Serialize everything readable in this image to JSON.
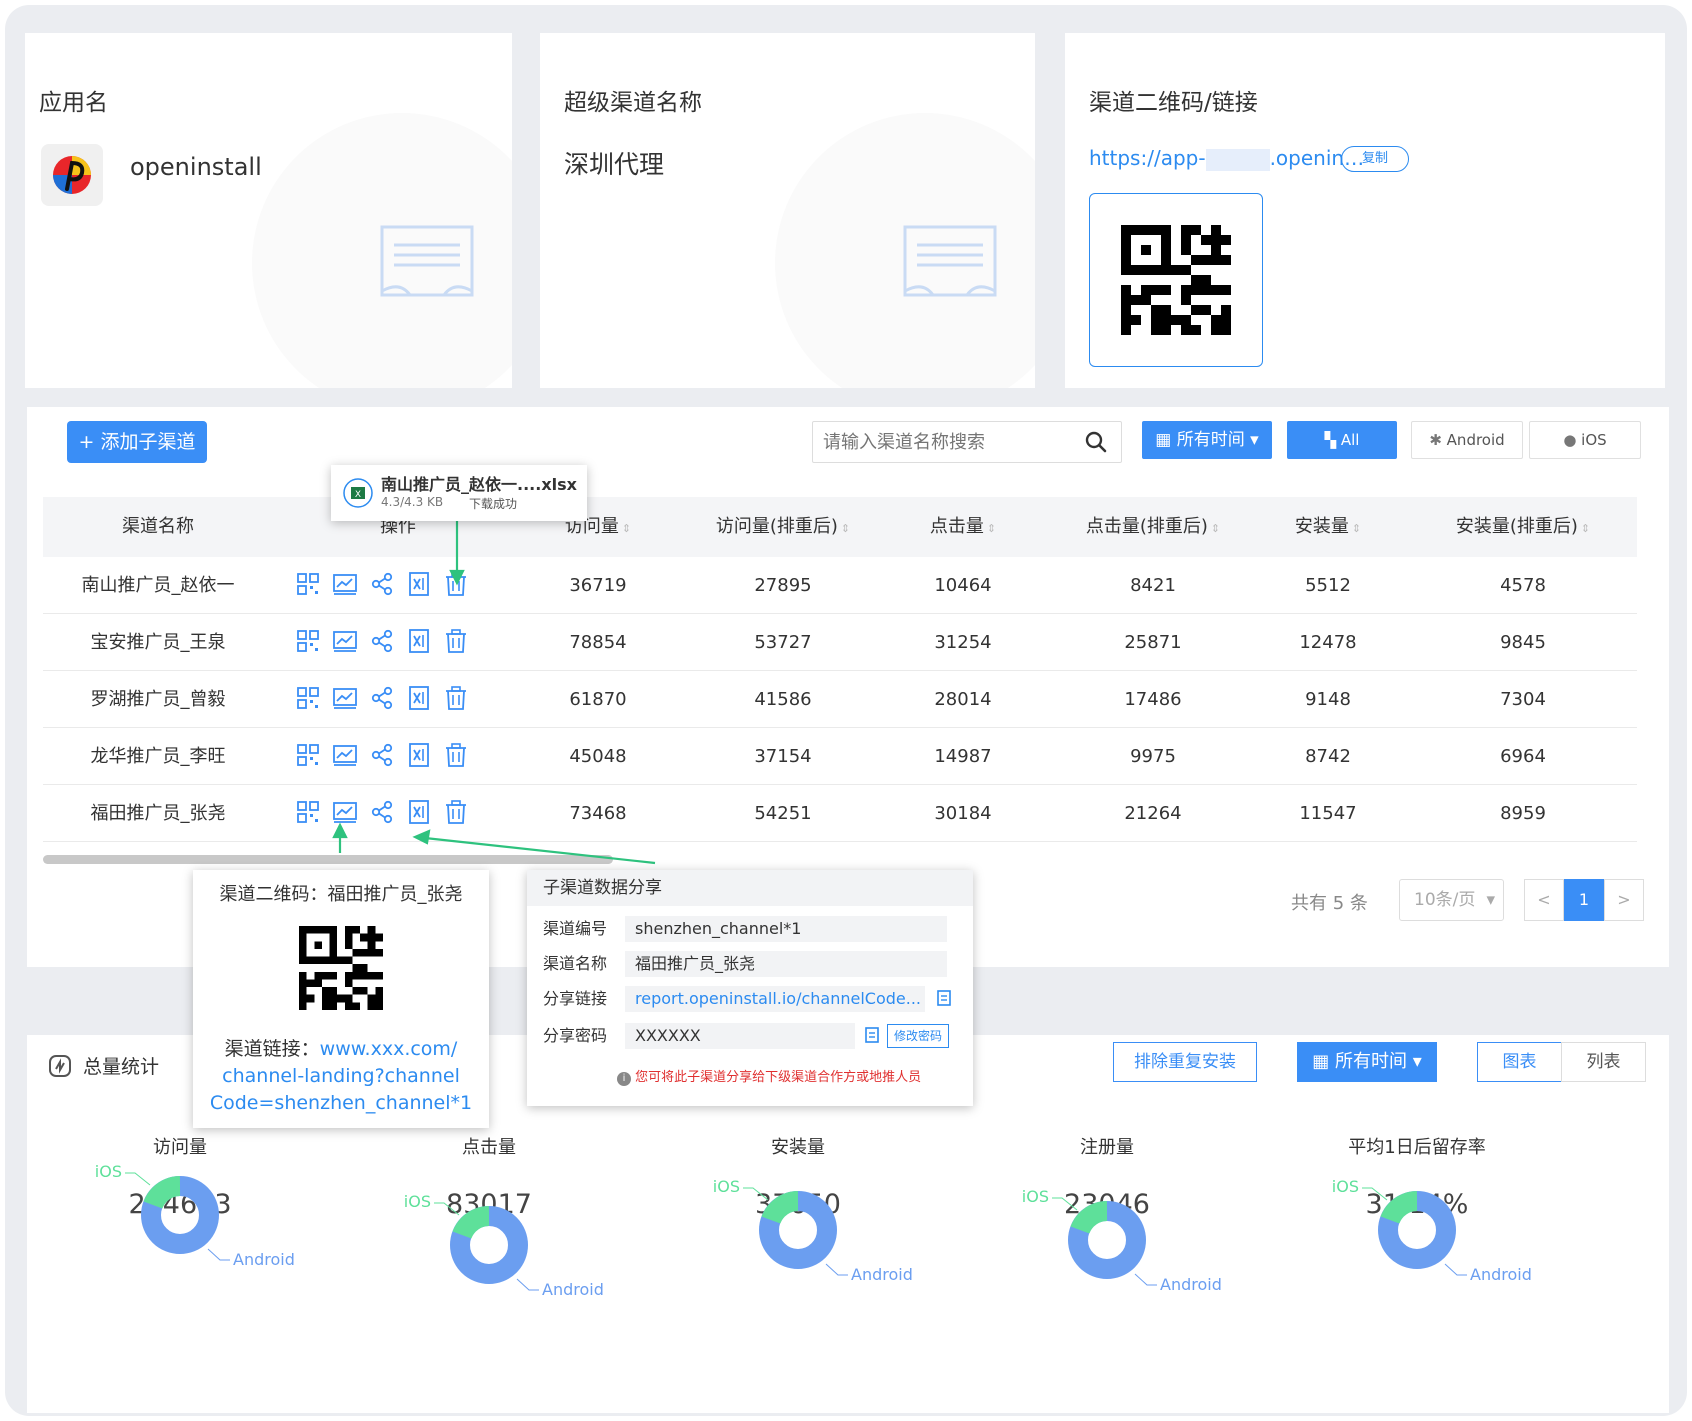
{
  "app_card": {
    "title": "应用名",
    "app_name": "openinstall"
  },
  "channel_card": {
    "title": "超级渠道名称",
    "name": "深圳代理"
  },
  "link_card": {
    "title": "渠道二维码/链接",
    "link_prefix": "https://app-",
    "link_suffix": ".openin…",
    "copy_label": "复制"
  },
  "toolbar": {
    "add_label": "+ 添加子渠道",
    "search_placeholder": "请输入渠道名称搜索",
    "time_label": "所有时间",
    "all_label": "All",
    "android_label": "Android",
    "ios_label": "iOS"
  },
  "file_toast": {
    "name": "南山推广员_赵依一....xlsx",
    "size": "4.3/4.3 KB",
    "status": "下载成功"
  },
  "table": {
    "headers": [
      "渠道名称",
      "操作",
      "访问量",
      "访问量(排重后)",
      "点击量",
      "点击量(排重后)",
      "安装量",
      "安装量(排重后)"
    ],
    "sort_icon": "⇕",
    "rows": [
      {
        "name": "南山推广员_赵依一",
        "v1": "36719",
        "v2": "27895",
        "v3": "10464",
        "v4": "8421",
        "v5": "5512",
        "v6": "4578"
      },
      {
        "name": "宝安推广员_王泉",
        "v1": "78854",
        "v2": "53727",
        "v3": "31254",
        "v4": "25871",
        "v5": "12478",
        "v6": "9845"
      },
      {
        "name": "罗湖推广员_曾毅",
        "v1": "61870",
        "v2": "41586",
        "v3": "28014",
        "v4": "17486",
        "v5": "9148",
        "v6": "7304"
      },
      {
        "name": "龙华推广员_李旺",
        "v1": "45048",
        "v2": "37154",
        "v3": "14987",
        "v4": "9975",
        "v5": "8742",
        "v6": "6964"
      },
      {
        "name": "福田推广员_张尧",
        "v1": "73468",
        "v2": "54251",
        "v3": "30184",
        "v4": "21264",
        "v5": "11547",
        "v6": "8959"
      }
    ]
  },
  "pager": {
    "total": "共有 5 条",
    "page_size": "10条/页",
    "prev": "<",
    "current": "1",
    "next": ">"
  },
  "qr_popup": {
    "title": "渠道二维码：福田推广员_张尧",
    "link_label": "渠道链接：",
    "link_1": "www.xxx.com/",
    "link_2": "channel-landing?channel",
    "link_3": "Code=shenzhen_channel*1"
  },
  "share_popup": {
    "title": "子渠道数据分享",
    "code_label": "渠道编号",
    "code_value": "shenzhen_channel*1",
    "name_label": "渠道名称",
    "name_value": "福田推广员_张尧",
    "link_label": "分享链接",
    "link_value": "report.openinstall.io/channelCode...",
    "pwd_label": "分享密码",
    "pwd_value": "XXXXXX",
    "pwd_btn": "修改密码",
    "note": "您可将此子渠道分享给下级渠道合作方或地推人员"
  },
  "stats": {
    "title": "总量统计",
    "dedupe_label": "排除重复安装",
    "time_label": "所有时间",
    "chart_label": "图表",
    "list_label": "列表",
    "items": [
      {
        "label": "访问量",
        "value": "214613",
        "ios": "iOS",
        "android": "Android"
      },
      {
        "label": "点击量",
        "value": "83017",
        "ios": "iOS",
        "android": "Android"
      },
      {
        "label": "安装量",
        "value": "37650",
        "ios": "iOS",
        "android": "Android"
      },
      {
        "label": "注册量",
        "value": "23046",
        "ios": "iOS",
        "android": "Android"
      },
      {
        "label": "平均1日后留存率",
        "value": "31.14%",
        "ios": "iOS",
        "android": "Android"
      }
    ]
  },
  "colors": {
    "primary": "#3a8ef6",
    "ios_green": "#5ee09a",
    "android_blue": "#6b9ef0",
    "annotation_green": "#2ec27e"
  }
}
